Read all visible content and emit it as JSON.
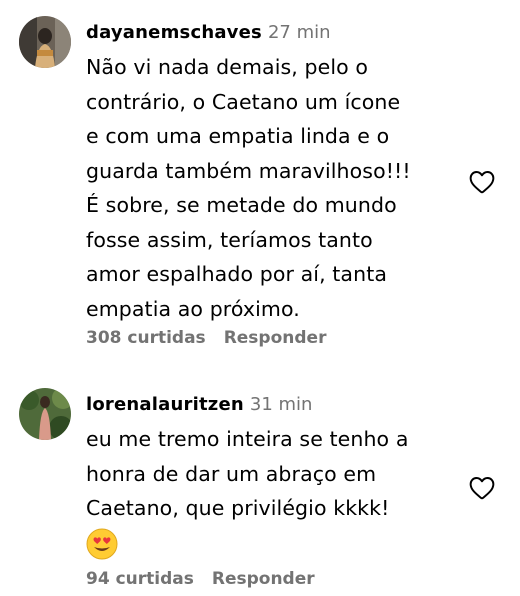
{
  "comments": [
    {
      "username": "dayanemschaves",
      "time": "27 min",
      "lines": [
        "Não vi nada demais, pelo o",
        "contrário, o Caetano um ícone",
        "e com uma empatia linda e o",
        "guarda também maravilhoso!!!",
        "É sobre, se metade do mundo",
        "fosse assim, teríamos tanto",
        "amor espalhado por aí, tanta",
        "empatia ao próximo."
      ],
      "likes": "308 curtidas",
      "reply_label": "Responder"
    },
    {
      "username": "lorenalauritzen",
      "time": "31 min",
      "lines": [
        "eu me tremo inteira se tenho a",
        "honra de dar um abraço em",
        "Caetano, que privilégio kkkk!"
      ],
      "emoji": "heart-eyes-emoji",
      "likes": "94 curtidas",
      "reply_label": "Responder"
    }
  ],
  "colors": {
    "text": "#000000",
    "secondary": "#737373",
    "emoji_face": "#FFCC33",
    "emoji_heart": "#E8363C"
  },
  "icons": [
    "like-heart-icon"
  ]
}
